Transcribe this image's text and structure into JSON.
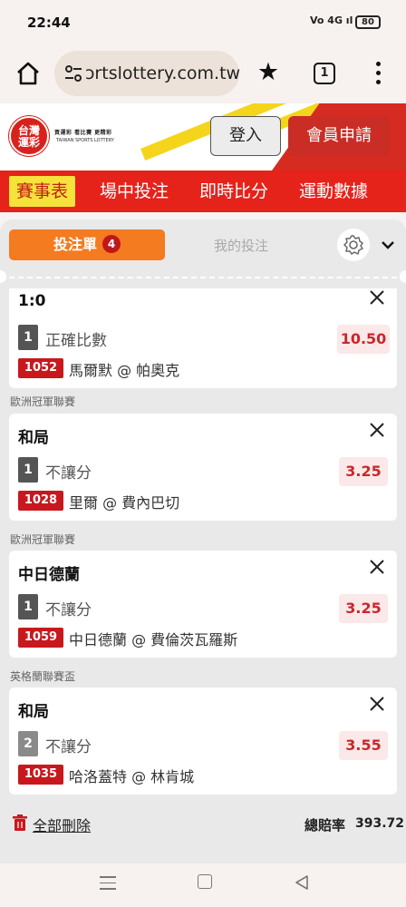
{
  "status_bar": {
    "time": "22:44",
    "signal": "Vo 4G ıl",
    "battery": "80"
  },
  "browser": {
    "url": "ɔrtslottery.com.tw",
    "tab_count": "1",
    "icons": [
      "home-icon",
      "site-settings-icon",
      "star-icon",
      "tabs-icon",
      "more-vert-icon"
    ]
  },
  "site_header": {
    "logo_text_line1": "台灣",
    "logo_text_line2": "運彩",
    "slogan": "買運彩  看比賽  更精彩",
    "english_name": "TAIWAN SPORTS LOTTERY",
    "login_label": "登入",
    "signup_label": "會員申請"
  },
  "nav": {
    "items": [
      {
        "label": "賽事表",
        "active": true
      },
      {
        "label": "場中投注",
        "active": false
      },
      {
        "label": "即時比分",
        "active": false
      },
      {
        "label": "運動數據",
        "active": false
      }
    ]
  },
  "slip": {
    "tab_label": "投注單",
    "tab_count": "4",
    "my_bets_label": "我的投注",
    "bets": [
      {
        "league": "",
        "pick": "1:0",
        "num": "1",
        "market": "正確比數",
        "code": "1052",
        "match": "馬爾默 @ 帕奧克",
        "odds": "10.50"
      },
      {
        "league": "歐洲冠軍聯賽",
        "pick": "和局",
        "num": "1",
        "market": "不讓分",
        "code": "1028",
        "match": "里爾 @ 費內巴切",
        "odds": "3.25"
      },
      {
        "league": "歐洲冠軍聯賽",
        "pick": "中日德蘭",
        "num": "1",
        "market": "不讓分",
        "code": "1059",
        "match": "中日德蘭 @ 費倫茨瓦羅斯",
        "odds": "3.25"
      },
      {
        "league": "英格蘭聯賽盃",
        "pick": "和局",
        "num": "2",
        "market": "不讓分",
        "code": "1035",
        "match": "哈洛蓋特 @ 林肯城",
        "odds": "3.55"
      }
    ],
    "delete_all_label": "全部刪除",
    "total_odds_label": "總賠率",
    "total_odds_value": "393.72"
  },
  "colors": {
    "brand_red": "#e5231b",
    "accent_orange": "#f47b20",
    "highlight_yellow": "#f5e23a",
    "odds_red": "#c7282d"
  }
}
